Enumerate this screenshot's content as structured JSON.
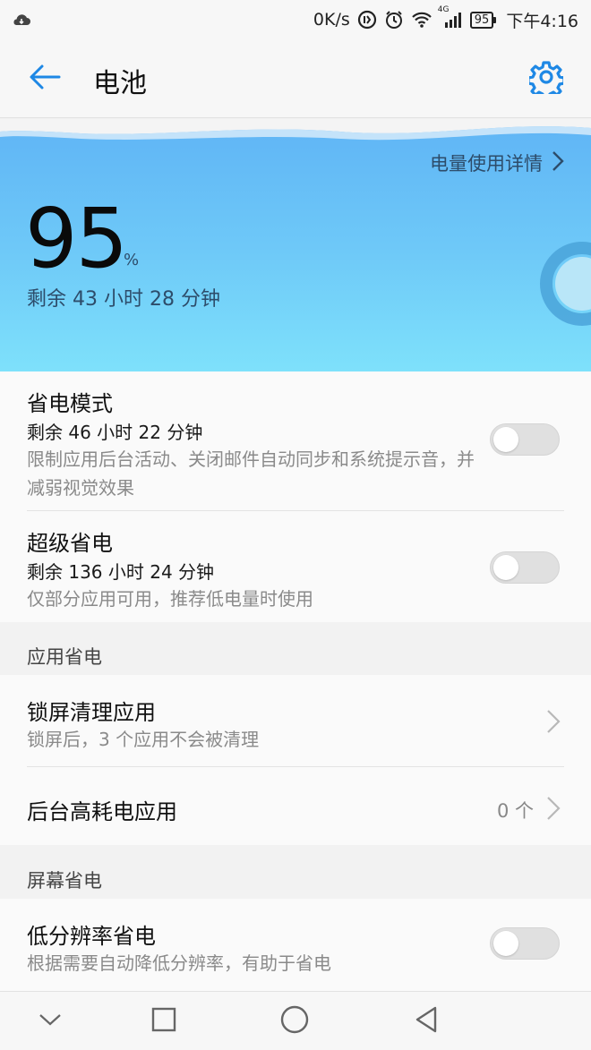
{
  "status_bar": {
    "network_speed": "0K/s",
    "network_type": "4G",
    "battery_level": "95",
    "time": "下午4:16",
    "icons": [
      "cloud-icon",
      "data-saver-icon",
      "alarm-icon",
      "wifi-icon",
      "cell-signal-icon",
      "battery-icon"
    ]
  },
  "header": {
    "title": "电池",
    "back_icon": "arrow-left-icon",
    "settings_icon": "gear-icon"
  },
  "hero": {
    "details_link": "电量使用详情",
    "battery_percent": "95",
    "percent_sign": "%",
    "remaining": "剩余 43 小时 28 分钟",
    "battery_fraction": 0.95
  },
  "power_saving": {
    "title": "省电模式",
    "remaining": "剩余 46 小时 22 分钟",
    "description": "限制应用后台活动、关闭邮件自动同步和系统提示音，并减弱视觉效果",
    "enabled": false
  },
  "ultra_power_saving": {
    "title": "超级省电",
    "remaining": "剩余 136 小时 24 分钟",
    "description": "仅部分应用可用，推荐低电量时使用",
    "enabled": false
  },
  "app_saving": {
    "section_title": "应用省电",
    "lock_screen_cleanup": {
      "title": "锁屏清理应用",
      "description": "锁屏后，3 个应用不会被清理"
    },
    "background_high_drain": {
      "title": "后台高耗电应用",
      "count": "0 个"
    }
  },
  "screen_saving": {
    "section_title": "屏幕省电",
    "low_resolution": {
      "title": "低分辨率省电",
      "description": "根据需要自动降低分辨率，有助于省电",
      "enabled": false
    }
  },
  "nav_bar": {
    "icons": [
      "chevron-down-icon",
      "square-icon",
      "circle-icon",
      "triangle-back-icon"
    ]
  },
  "colors": {
    "accent": "#1e88e5",
    "hero_top": "#5fb4f5",
    "hero_bottom": "#7ee1fb",
    "toggle_off": "#e0e0e0"
  }
}
